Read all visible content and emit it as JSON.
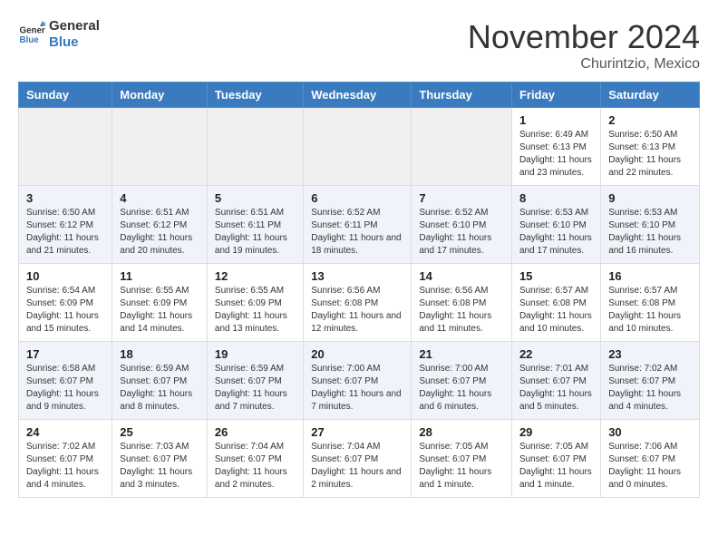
{
  "header": {
    "logo_general": "General",
    "logo_blue": "Blue",
    "month_title": "November 2024",
    "location": "Churintzio, Mexico"
  },
  "weekdays": [
    "Sunday",
    "Monday",
    "Tuesday",
    "Wednesday",
    "Thursday",
    "Friday",
    "Saturday"
  ],
  "weeks": [
    [
      {
        "day": "",
        "info": ""
      },
      {
        "day": "",
        "info": ""
      },
      {
        "day": "",
        "info": ""
      },
      {
        "day": "",
        "info": ""
      },
      {
        "day": "",
        "info": ""
      },
      {
        "day": "1",
        "info": "Sunrise: 6:49 AM\nSunset: 6:13 PM\nDaylight: 11 hours and 23 minutes."
      },
      {
        "day": "2",
        "info": "Sunrise: 6:50 AM\nSunset: 6:13 PM\nDaylight: 11 hours and 22 minutes."
      }
    ],
    [
      {
        "day": "3",
        "info": "Sunrise: 6:50 AM\nSunset: 6:12 PM\nDaylight: 11 hours and 21 minutes."
      },
      {
        "day": "4",
        "info": "Sunrise: 6:51 AM\nSunset: 6:12 PM\nDaylight: 11 hours and 20 minutes."
      },
      {
        "day": "5",
        "info": "Sunrise: 6:51 AM\nSunset: 6:11 PM\nDaylight: 11 hours and 19 minutes."
      },
      {
        "day": "6",
        "info": "Sunrise: 6:52 AM\nSunset: 6:11 PM\nDaylight: 11 hours and 18 minutes."
      },
      {
        "day": "7",
        "info": "Sunrise: 6:52 AM\nSunset: 6:10 PM\nDaylight: 11 hours and 17 minutes."
      },
      {
        "day": "8",
        "info": "Sunrise: 6:53 AM\nSunset: 6:10 PM\nDaylight: 11 hours and 17 minutes."
      },
      {
        "day": "9",
        "info": "Sunrise: 6:53 AM\nSunset: 6:10 PM\nDaylight: 11 hours and 16 minutes."
      }
    ],
    [
      {
        "day": "10",
        "info": "Sunrise: 6:54 AM\nSunset: 6:09 PM\nDaylight: 11 hours and 15 minutes."
      },
      {
        "day": "11",
        "info": "Sunrise: 6:55 AM\nSunset: 6:09 PM\nDaylight: 11 hours and 14 minutes."
      },
      {
        "day": "12",
        "info": "Sunrise: 6:55 AM\nSunset: 6:09 PM\nDaylight: 11 hours and 13 minutes."
      },
      {
        "day": "13",
        "info": "Sunrise: 6:56 AM\nSunset: 6:08 PM\nDaylight: 11 hours and 12 minutes."
      },
      {
        "day": "14",
        "info": "Sunrise: 6:56 AM\nSunset: 6:08 PM\nDaylight: 11 hours and 11 minutes."
      },
      {
        "day": "15",
        "info": "Sunrise: 6:57 AM\nSunset: 6:08 PM\nDaylight: 11 hours and 10 minutes."
      },
      {
        "day": "16",
        "info": "Sunrise: 6:57 AM\nSunset: 6:08 PM\nDaylight: 11 hours and 10 minutes."
      }
    ],
    [
      {
        "day": "17",
        "info": "Sunrise: 6:58 AM\nSunset: 6:07 PM\nDaylight: 11 hours and 9 minutes."
      },
      {
        "day": "18",
        "info": "Sunrise: 6:59 AM\nSunset: 6:07 PM\nDaylight: 11 hours and 8 minutes."
      },
      {
        "day": "19",
        "info": "Sunrise: 6:59 AM\nSunset: 6:07 PM\nDaylight: 11 hours and 7 minutes."
      },
      {
        "day": "20",
        "info": "Sunrise: 7:00 AM\nSunset: 6:07 PM\nDaylight: 11 hours and 7 minutes."
      },
      {
        "day": "21",
        "info": "Sunrise: 7:00 AM\nSunset: 6:07 PM\nDaylight: 11 hours and 6 minutes."
      },
      {
        "day": "22",
        "info": "Sunrise: 7:01 AM\nSunset: 6:07 PM\nDaylight: 11 hours and 5 minutes."
      },
      {
        "day": "23",
        "info": "Sunrise: 7:02 AM\nSunset: 6:07 PM\nDaylight: 11 hours and 4 minutes."
      }
    ],
    [
      {
        "day": "24",
        "info": "Sunrise: 7:02 AM\nSunset: 6:07 PM\nDaylight: 11 hours and 4 minutes."
      },
      {
        "day": "25",
        "info": "Sunrise: 7:03 AM\nSunset: 6:07 PM\nDaylight: 11 hours and 3 minutes."
      },
      {
        "day": "26",
        "info": "Sunrise: 7:04 AM\nSunset: 6:07 PM\nDaylight: 11 hours and 2 minutes."
      },
      {
        "day": "27",
        "info": "Sunrise: 7:04 AM\nSunset: 6:07 PM\nDaylight: 11 hours and 2 minutes."
      },
      {
        "day": "28",
        "info": "Sunrise: 7:05 AM\nSunset: 6:07 PM\nDaylight: 11 hours and 1 minute."
      },
      {
        "day": "29",
        "info": "Sunrise: 7:05 AM\nSunset: 6:07 PM\nDaylight: 11 hours and 1 minute."
      },
      {
        "day": "30",
        "info": "Sunrise: 7:06 AM\nSunset: 6:07 PM\nDaylight: 11 hours and 0 minutes."
      }
    ]
  ]
}
